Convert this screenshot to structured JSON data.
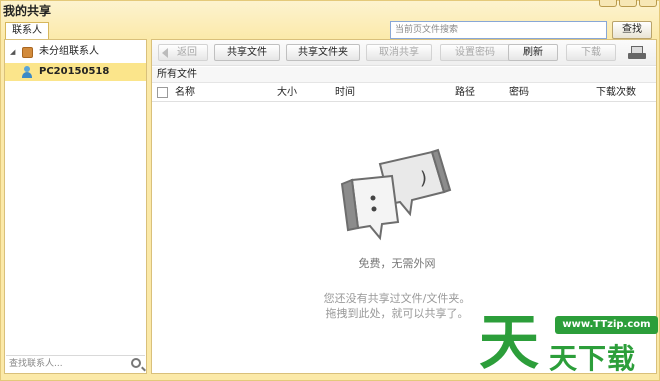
{
  "window": {
    "title": "我的共享"
  },
  "tabs": [
    {
      "label": "联系人"
    }
  ],
  "search": {
    "placeholder": "当前页文件搜索",
    "button_label": "查找"
  },
  "sidebar": {
    "group_label": "未分组联系人",
    "contact_label": "PC20150518",
    "search_placeholder": "查找联系人..."
  },
  "toolbar": {
    "back_label": "返回",
    "share_file_label": "共享文件",
    "share_folder_label": "共享文件夹",
    "unshare_label": "取消共享",
    "set_password_label": "设置密码",
    "refresh_label": "刷新",
    "download_label": "下载"
  },
  "breadcrumb": "所有文件",
  "columns": {
    "name": "名称",
    "size": "大小",
    "time": "时间",
    "path": "路径",
    "password": "密码",
    "downloads": "下载次数"
  },
  "empty_state": {
    "title": "免费，无需外网",
    "line1": "您还没有共享过文件/文件夹。",
    "line2": "拖拽到此处，就可以共享了。"
  },
  "watermark": {
    "site": "www.TTzip.com",
    "big": "天",
    "small": "天下载"
  },
  "colors": {
    "accent": "#fbe58b",
    "watermark_green": "#2c9e3a"
  },
  "icons": [
    "folder-group-icon",
    "person-icon",
    "search-icon",
    "tray-icon",
    "chat-bubbles-icon"
  ]
}
